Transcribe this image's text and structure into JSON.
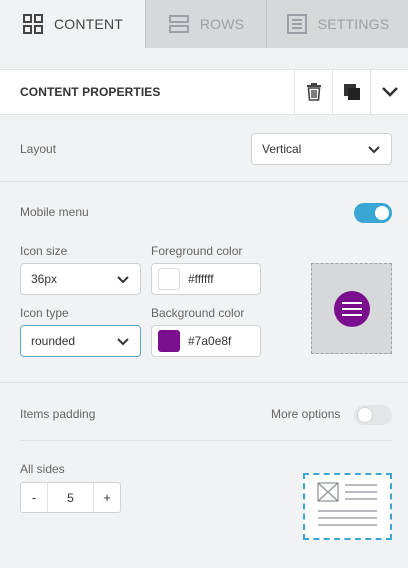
{
  "tabs": {
    "content": {
      "label": "CONTENT",
      "icon": "grid-icon"
    },
    "rows": {
      "label": "ROWS",
      "icon": "rows-icon"
    },
    "settings": {
      "label": "SETTINGS",
      "icon": "settings-list-icon"
    }
  },
  "header": {
    "title": "CONTENT PROPERTIES",
    "actions": [
      "trash-icon",
      "duplicate-icon",
      "collapse-chevron-icon"
    ]
  },
  "layout": {
    "label": "Layout",
    "value": "Vertical"
  },
  "mobile_menu": {
    "label": "Mobile menu",
    "enabled": true,
    "icon_size": {
      "label": "Icon size",
      "value": "36px"
    },
    "icon_type": {
      "label": "Icon type",
      "value": "rounded"
    },
    "foreground": {
      "label": "Foreground color",
      "value": "#ffffff"
    },
    "background": {
      "label": "Background color",
      "value": "#7a0e8f"
    }
  },
  "items_padding": {
    "label": "Items padding",
    "more_options_label": "More options",
    "more_options_enabled": false,
    "all_sides": {
      "label": "All sides",
      "value": "5",
      "decrement": "-",
      "increment": "+"
    }
  },
  "colors": {
    "accent": "#3aa6d4",
    "menu_bg": "#7a0e8f"
  }
}
